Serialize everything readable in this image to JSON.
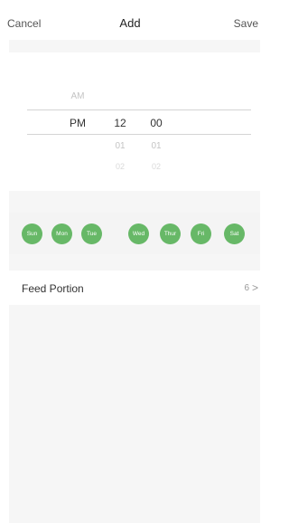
{
  "nav": {
    "cancel_label": "Cancel",
    "title": "Add",
    "save_label": "Save"
  },
  "time_picker": {
    "period_options": [
      "AM",
      "PM"
    ],
    "selected_period": "PM",
    "selected_hour": "12",
    "selected_minute": "00",
    "hours_below": [
      "01",
      "02"
    ],
    "minutes_below": [
      "01",
      "02"
    ]
  },
  "days": [
    {
      "label": "Sun"
    },
    {
      "label": "Mon"
    },
    {
      "label": "Tue"
    },
    {
      "label": "Wed"
    },
    {
      "label": "Thur"
    },
    {
      "label": "Fri"
    },
    {
      "label": "Sat"
    }
  ],
  "feed_portion": {
    "label": "Feed Portion",
    "value": "6",
    "chevron": ">"
  },
  "colors": {
    "day_selected": "#67b867",
    "background": "#f6f6f6"
  }
}
